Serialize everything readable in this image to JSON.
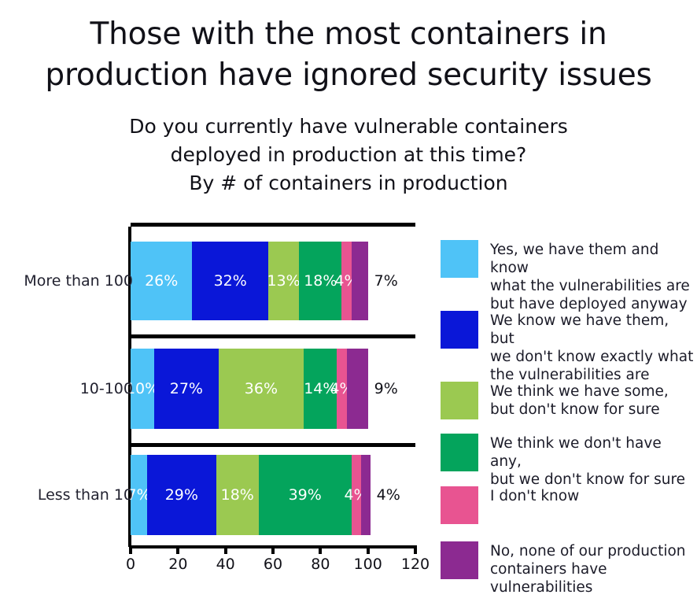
{
  "title": {
    "line1": "Those with the most containers in",
    "line2": "production have ignored security issues"
  },
  "subtitle": {
    "line1": "Do you currently have vulnerable containers",
    "line2": "deployed in production at this time?",
    "line3": "By # of containers in production"
  },
  "chart_data": {
    "type": "bar",
    "orientation": "horizontal",
    "stacked": true,
    "title": "Those with the most containers in production have ignored security issues",
    "subtitle": "Do you currently have vulnerable containers deployed in production at this time? By # of containers in production",
    "xlabel": "",
    "ylabel": "",
    "xlim": [
      0,
      120
    ],
    "xticks": [
      0,
      20,
      40,
      60,
      80,
      100,
      120
    ],
    "xtick_labels": [
      "0",
      "20",
      "40",
      "60",
      "80",
      "100",
      "120"
    ],
    "grid": false,
    "legend_position": "right",
    "categories": [
      "More than 100",
      "10-100",
      "Less than 10"
    ],
    "series": [
      {
        "name": "Yes, we have them and know what the vulnerabilities are but have deployed anyway",
        "color": "#4FC3F7",
        "values": [
          26,
          10,
          7
        ],
        "labels": [
          "26%",
          "10%",
          "7%"
        ]
      },
      {
        "name": "We know we have them, but we don't know exactly what the vulnerabilities are",
        "color": "#0A17D8",
        "values": [
          32,
          27,
          29
        ],
        "labels": [
          "32%",
          "27%",
          "29%"
        ]
      },
      {
        "name": "We think we have some, but don't know for sure",
        "color": "#9BC951",
        "values": [
          13,
          36,
          18
        ],
        "labels": [
          "13%",
          "36%",
          "18%"
        ]
      },
      {
        "name": "We think we don't have any, but we don't know for sure",
        "color": "#04A45C",
        "values": [
          18,
          14,
          39
        ],
        "labels": [
          "18%",
          "14%",
          "39%"
        ]
      },
      {
        "name": "I don't know",
        "color": "#E85491",
        "values": [
          4,
          4,
          4
        ],
        "labels": [
          "4%",
          "4%",
          "4%"
        ]
      },
      {
        "name": "No, none of our production containers have vulnerabilities",
        "color": "#8C2A91",
        "values": [
          7,
          9,
          4
        ],
        "labels": [
          "7%",
          "9%",
          "4%"
        ]
      }
    ]
  },
  "legend": {
    "items": [
      {
        "color": "#4FC3F7",
        "label": "Yes, we have them and know\nwhat the vulnerabilities are\nbut have deployed anyway"
      },
      {
        "color": "#0A17D8",
        "label": "We know we have them, but\nwe don't know exactly what\nthe vulnerabilities are"
      },
      {
        "color": "#9BC951",
        "label": "We think we have some,\nbut don't know for sure"
      },
      {
        "color": "#04A45C",
        "label": "We think we don't have any,\nbut we don't know for sure"
      },
      {
        "color": "#E85491",
        "label": "I don't know"
      },
      {
        "color": "#8C2A91",
        "label": "No, none of our production\ncontainers have vulnerabilities"
      }
    ]
  }
}
